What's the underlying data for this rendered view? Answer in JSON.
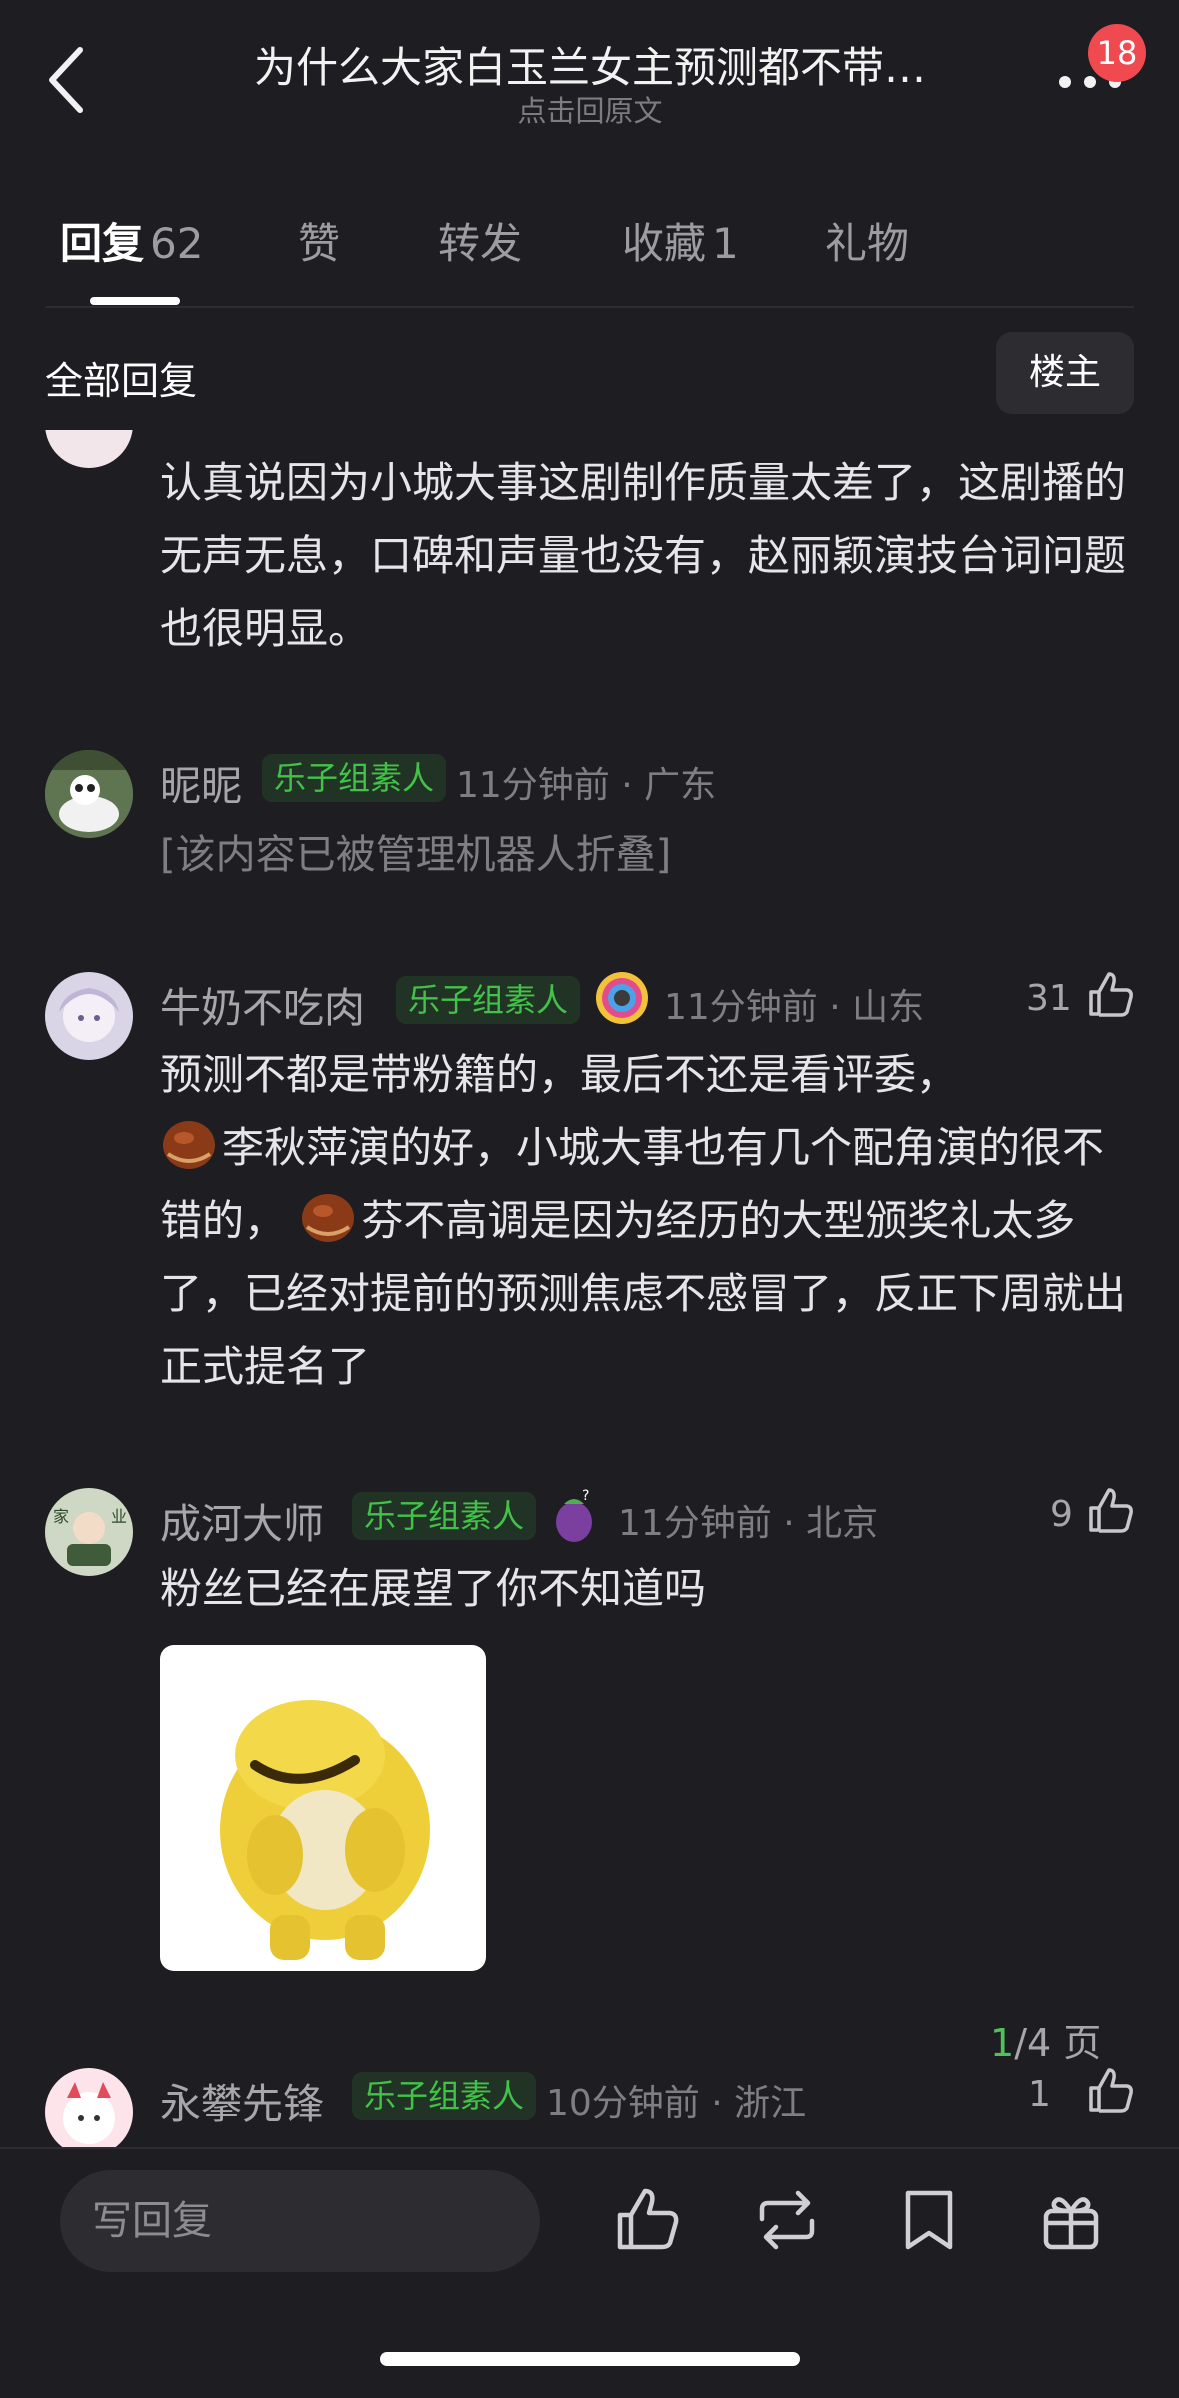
{
  "header": {
    "title": "为什么大家白玉兰女主预测都不带…",
    "subtitle": "点击回原文",
    "badge": "18"
  },
  "tabs": [
    {
      "label": "回复",
      "count": "62"
    },
    {
      "label": "赞",
      "count": ""
    },
    {
      "label": "转发",
      "count": ""
    },
    {
      "label": "收藏",
      "count": "1"
    },
    {
      "label": "礼物",
      "count": ""
    }
  ],
  "filter": {
    "label": "全部回复",
    "louzhu": "楼主"
  },
  "comments": [
    {
      "text": "认真说因为小城大事这剧制作质量太差了，这剧播的无声无息，口碑和声量也没有，赵丽颖演技台词问题也很明显。"
    },
    {
      "name": "昵昵",
      "tag": "乐子组素人",
      "meta": "11分钟前 · 广东",
      "text": "[该内容已被管理机器人折叠]"
    },
    {
      "name": "牛奶不吃肉",
      "tag": "乐子组素人",
      "meta": "11分钟前 · 山东",
      "likes": "31",
      "text_parts": [
        "预测不都是带粉籍的，最后不还是看评委，",
        "李秋萍演的好，小城大事也有几个配角演的很不错的，",
        "芬不高调是因为经历的大型颁奖礼太多了，已经对提前的预测焦虑不感冒了，反正下周就出正式提名了"
      ]
    },
    {
      "name": "成河大师",
      "tag": "乐子组素人",
      "meta": "11分钟前 · 北京",
      "likes": "9",
      "text": "粉丝已经在展望了你不知道吗"
    },
    {
      "name": "永攀先锋",
      "tag": "乐子组素人",
      "meta": "10分钟前 · 浙江",
      "likes": "1"
    }
  ],
  "pager": {
    "current": "1",
    "total": "/4 页"
  },
  "bottom": {
    "reply_placeholder": "写回复"
  },
  "colors": {
    "background": "#1e1e22",
    "tag_green": "#42c248",
    "badge_red": "#f04950"
  }
}
